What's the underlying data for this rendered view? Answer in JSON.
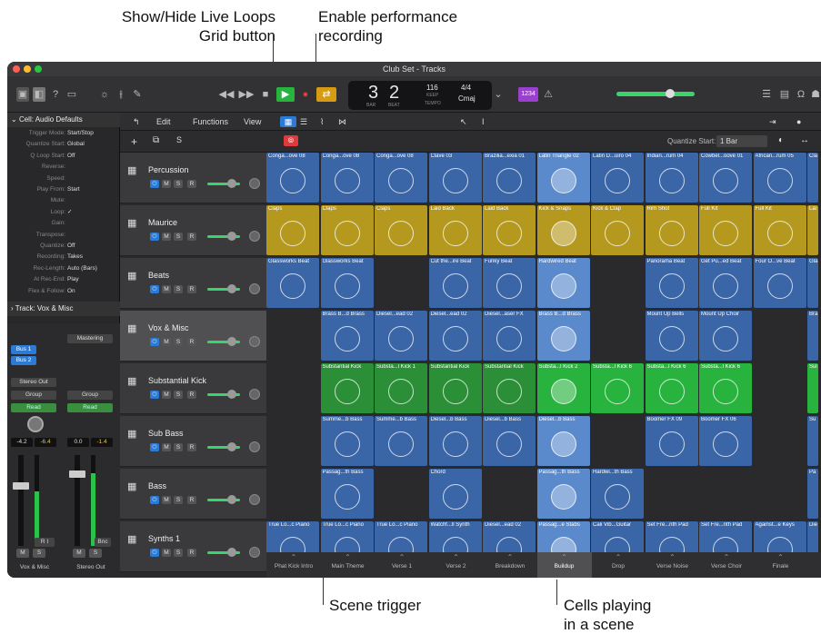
{
  "callouts": {
    "live_loops_grid": "Show/Hide Live Loops\nGrid button",
    "perf_recording": "Enable performance\nrecording",
    "scene_trigger": "Scene trigger",
    "cells_playing": "Cells playing\nin a scene"
  },
  "window": {
    "title": "Club Set - Tracks"
  },
  "lcd": {
    "bar": "3",
    "beat": "2",
    "bar_label": "BAR",
    "beat_label": "BEAT",
    "tempo": "116",
    "tempo_label": "KEEP",
    "tempo_sub": "TEMPO",
    "sig": "4/4",
    "key": "Cmaj"
  },
  "control_bar": {
    "count_in": "1234"
  },
  "toolbar": {
    "edit": "Edit",
    "functions": "Functions",
    "view": "View",
    "quantize_start_label": "Quantize Start:",
    "quantize_start_value": "1 Bar"
  },
  "inspector": {
    "cell_header": "Cell: Audio Defaults",
    "rows": [
      {
        "k": "Trigger Mode:",
        "v": "Start/Stop"
      },
      {
        "k": "Quantize Start:",
        "v": "Global"
      },
      {
        "k": "Q Loop Start:",
        "v": "Off"
      },
      {
        "k": "Reverse:",
        "v": ""
      },
      {
        "k": "Speed:",
        "v": ""
      },
      {
        "k": "Play From:",
        "v": "Start"
      },
      {
        "k": "Mute:",
        "v": ""
      },
      {
        "k": "Loop:",
        "v": "✓"
      },
      {
        "k": "Gain:",
        "v": ""
      },
      {
        "k": "Transpose:",
        "v": ""
      },
      {
        "k": "Quantize:",
        "v": "Off"
      },
      {
        "k": "Recording:",
        "v": "Takes"
      },
      {
        "k": "Rec-Length:",
        "v": "Auto (Bars)"
      },
      {
        "k": "At Rec-End:",
        "v": "Play"
      },
      {
        "k": "Flex & Follow:",
        "v": "On"
      }
    ],
    "track_header": "Track: Vox & Misc"
  },
  "mixer": {
    "insert": "Mastering",
    "bus1": "Bus 1",
    "bus2": "Bus 2",
    "stereo_out": "Stereo Out",
    "group": "Group",
    "read": "Read",
    "vol_a": "-4.2",
    "pk_a": "-6.4",
    "vol_b": "0.0",
    "pk_b": "-1.4",
    "bnc": "Bnc",
    "ri": "R I",
    "m": "M",
    "s": "S",
    "strip_a": "Vox & Misc",
    "strip_b": "Stereo Out"
  },
  "tracks": [
    {
      "name": "Percussion",
      "icon": "drum-icon"
    },
    {
      "name": "Maurice",
      "icon": "keyboard-icon"
    },
    {
      "name": "Beats",
      "icon": "keyboard-icon"
    },
    {
      "name": "Vox & Misc",
      "icon": "guitar-icon"
    },
    {
      "name": "Substantial Kick",
      "icon": "synth-icon"
    },
    {
      "name": "Sub Bass",
      "icon": "synth-icon"
    },
    {
      "name": "Bass",
      "icon": "synth-icon"
    },
    {
      "name": "Synths 1",
      "icon": "synth-icon"
    }
  ],
  "track_buttons": {
    "m": "M",
    "s": "S",
    "r": "R"
  },
  "cells": [
    [
      "Conga...ove 08",
      "Conga...ove 08",
      "Conga...ove 08",
      "Clave 03",
      "Brazilia...exia 01",
      "Latin Triangle 02",
      "Latin D...uiro 04",
      "Indian...rum 04",
      "Cowbel...oove 01",
      "African...rum 05",
      "Cla"
    ],
    [
      "Claps",
      "Claps",
      "Claps",
      "Laid Back",
      "Laid Back",
      "Kick & Snaps",
      "Kick & Clap",
      "Rim Shot",
      "Full Kit",
      "Full Kit",
      "Lai"
    ],
    [
      "Glassworks Beat",
      "Glassworks Beat",
      "",
      "Cut the...ire Beat",
      "Funky Beat",
      "Hardwired Beat",
      "",
      "Panorama Beat",
      "Get Pu...ed Beat",
      "Four O...ve Beat",
      "Gla"
    ],
    [
      "",
      "Brass B...d Brass",
      "Diesel...ead 02",
      "Diesel...ead 02",
      "Diesel...aser FX",
      "Brass B...d Brass",
      "",
      "Mount Up Bells",
      "Mount Up Choir",
      "",
      "Bra"
    ],
    [
      "",
      "Substantial Kick",
      "Substa...l Kick 1",
      "Substantial Kick",
      "Substantial Kick",
      "Substa...l Kick 2",
      "Substa...l Kick 6",
      "Substa...l Kick 6",
      "Substa...l Kick 6",
      "",
      "Sul"
    ],
    [
      "",
      "Summe...b Bass",
      "Summe...b Bass",
      "Diesel...b Bass",
      "Diesel...b Bass",
      "Diesel...b Bass",
      "",
      "Boomer FX 09",
      "Boomer FX 06",
      "",
      "Su"
    ],
    [
      "",
      "Passag...th Bass",
      "",
      "Chord",
      "",
      "Passag...th Bass",
      "Hardwi...th Bass",
      "",
      "",
      "",
      "Pa"
    ],
    [
      "True Lo...c Piano",
      "True Lo...c Piano",
      "True Lo...c Piano",
      "Watchf...ll Synth",
      "Diesel...ead 02",
      "Passag...e Stabs",
      "Cali Vib...Guitar",
      "Set Fre...nth Pad",
      "Set Fre...nth Pad",
      "Against...e Keys",
      "Die"
    ]
  ],
  "row_colors": [
    "b",
    "y",
    "b",
    "b",
    "g",
    "b",
    "b",
    "b"
  ],
  "scenes": [
    "Phat Kick Intro",
    "Main Theme",
    "Verse 1",
    "Verse 2",
    "Breakdown",
    "Buildup",
    "Drop",
    "Verse Noise",
    "Verse Choir",
    "Finale"
  ],
  "colors": {
    "accent_blue": "#2b7bd6",
    "play_green": "#27b33d",
    "record_red": "#e03a3a",
    "cell_blue": "#3a66a8",
    "cell_yellow": "#b5981e",
    "cell_green": "#2a8f36"
  }
}
